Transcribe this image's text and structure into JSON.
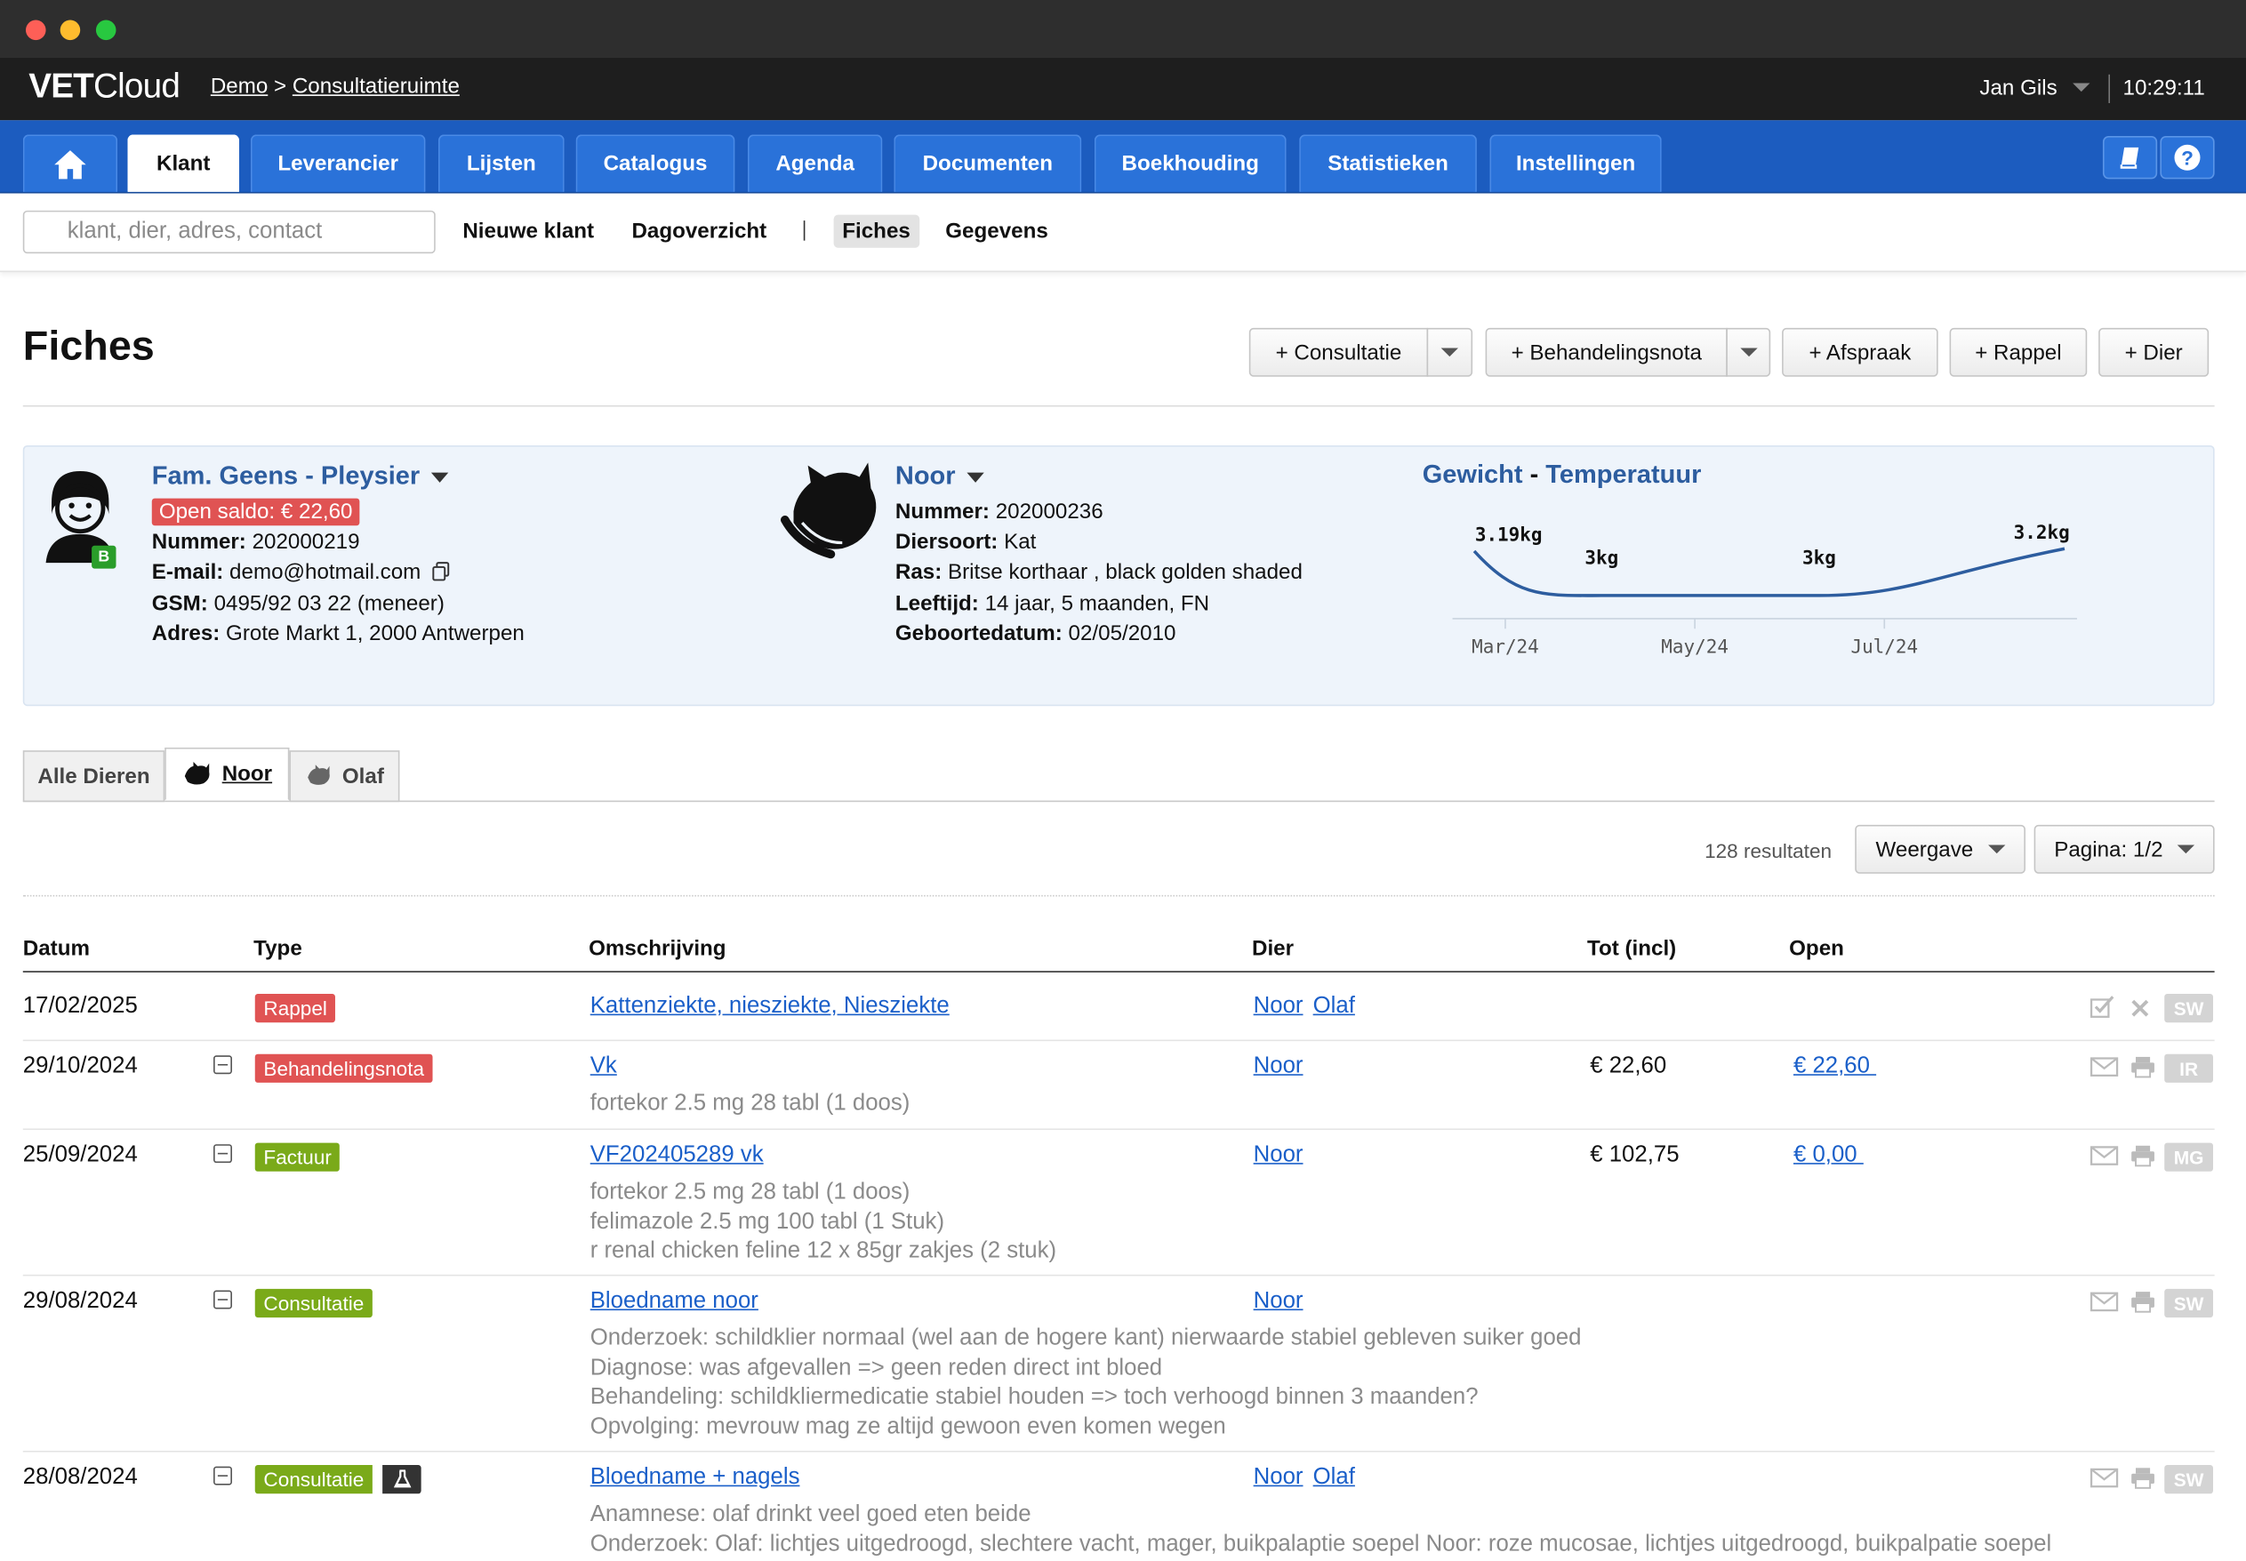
{
  "app": {
    "logo_bold": "VET",
    "logo_rest": "Cloud",
    "crumb_1": "Demo",
    "crumb_sep": ">",
    "crumb_2": "Consultatieruimte",
    "user": "Jan Gils",
    "time": "10:29:11"
  },
  "nav": {
    "tabs": [
      "Klant",
      "Leverancier",
      "Lijsten",
      "Catalogus",
      "Agenda",
      "Documenten",
      "Boekhouding",
      "Statistieken",
      "Instellingen"
    ],
    "active": "Klant"
  },
  "subnav": {
    "search_placeholder": "klant, dier, adres, contact",
    "links": [
      "Nieuwe klant",
      "Dagoverzicht",
      "Fiches",
      "Gegevens"
    ],
    "selected": "Fiches"
  },
  "page": {
    "title": "Fiches",
    "buttons": [
      "+ Consultatie",
      "+ Behandelingsnota",
      "+ Afspraak",
      "+ Rappel",
      "+ Dier"
    ]
  },
  "client": {
    "name": "Fam. Geens - Pleysier",
    "badge": "B",
    "saldo": "Open saldo: € 22,60",
    "fields": [
      {
        "label": "Nummer:",
        "value": "202000219"
      },
      {
        "label": "E-mail:",
        "value": "demo@hotmail.com"
      },
      {
        "label": "GSM:",
        "value": "0495/92 03 22 (meneer)"
      },
      {
        "label": "Adres:",
        "value": "Grote Markt 1, 2000 Antwerpen"
      }
    ]
  },
  "animal": {
    "name": "Noor",
    "fields": [
      {
        "label": "Nummer:",
        "value": "202000236"
      },
      {
        "label": "Diersoort:",
        "value": "Kat"
      },
      {
        "label": "Ras:",
        "value": "Britse korthaar , black golden shaded"
      },
      {
        "label": "Leeftijd:",
        "value": "14 jaar, 5 maanden, FN"
      },
      {
        "label": "Geboortedatum:",
        "value": "02/05/2010"
      }
    ]
  },
  "chart": {
    "title_a": "Gewicht",
    "title_sep": " - ",
    "title_b": "Temperatuur"
  },
  "chart_data": {
    "type": "line",
    "title": "Gewicht - Temperatuur",
    "x": [
      "2024-02-20",
      "2024-04-01",
      "2024-06-10",
      "2024-08-28"
    ],
    "series": [
      {
        "values": [
          3.19,
          3.0,
          3.0,
          3.2
        ]
      }
    ],
    "point_labels": [
      "3.19kg",
      "3kg",
      "3kg",
      "3.2kg"
    ],
    "tick_labels": [
      "Mar/24",
      "May/24",
      "Jul/24"
    ],
    "ylabel": "",
    "xlabel": "",
    "grid": false,
    "curve": "smooth",
    "color": "#2d5d9f"
  },
  "animal_tabs": [
    "Alle Dieren",
    "Noor",
    "Olaf"
  ],
  "animal_tab_active": "Noor",
  "results": {
    "count": "128 resultaten",
    "view": "Weergave",
    "page": "Pagina: 1/2"
  },
  "table": {
    "headers": [
      "Datum",
      "Type",
      "Omschrijving",
      "Dier",
      "Tot (incl)",
      "Open"
    ],
    "rows": [
      {
        "date": "17/02/2025",
        "type": "Rappel",
        "type_color": "#e05353",
        "title": "Kattenziekte, niesziekte, Niesziekte",
        "desc": [],
        "animals": [
          "Noor",
          "Olaf"
        ],
        "total": "",
        "open": "",
        "initials": "SW",
        "collapse": false,
        "lab": false,
        "actions": "check"
      },
      {
        "date": "29/10/2024",
        "type": "Behandelingsnota",
        "type_color": "#e05353",
        "title": "Vk",
        "desc": [
          "fortekor 2.5 mg 28 tabl (1 doos)"
        ],
        "animals": [
          "Noor"
        ],
        "total": "€ 22,60",
        "open": "€ 22,60 ",
        "initials": "IR",
        "collapse": true,
        "lab": false,
        "actions": "mail"
      },
      {
        "date": "25/09/2024",
        "type": "Factuur",
        "type_color": "#7aaa19",
        "title": "VF202405289 vk",
        "desc": [
          "fortekor 2.5 mg 28 tabl (1 doos)",
          "felimazole 2.5 mg 100 tabl (1 Stuk)",
          "r renal chicken feline 12 x 85gr zakjes (2 stuk)"
        ],
        "animals": [
          "Noor"
        ],
        "total": "€ 102,75",
        "open": "€ 0,00 ",
        "initials": "MG",
        "collapse": true,
        "lab": false,
        "actions": "mail"
      },
      {
        "date": "29/08/2024",
        "type": "Consultatie",
        "type_color": "#7aaa19",
        "title": "Bloedname noor",
        "desc": [
          "Onderzoek: schildklier normaal (wel aan de hogere kant) nierwaarde stabiel gebleven suiker goed",
          "Diagnose: was afgevallen => geen reden direct int bloed",
          "Behandeling: schildkliermedicatie stabiel houden => toch verhoogd binnen 3 maanden?",
          "Opvolging: mevrouw mag ze altijd gewoon even komen wegen"
        ],
        "animals": [
          "Noor"
        ],
        "total": "",
        "open": "",
        "initials": "SW",
        "collapse": true,
        "lab": false,
        "actions": "mail"
      },
      {
        "date": "28/08/2024",
        "type": "Consultatie",
        "type_color": "#7aaa19",
        "title": "Bloedname + nagels",
        "desc": [
          "Anamnese: olaf drinkt veel goed eten beide",
          "Onderzoek: Olaf: lichtjes uitgedroogd, slechtere vacht, mager, buikpalaptie soepel Noor: roze mucosae, lichtjes uitgedroogd, buikpalpatie soepel"
        ],
        "animals": [
          "Noor",
          "Olaf"
        ],
        "total": "",
        "open": "",
        "initials": "SW",
        "collapse": true,
        "lab": true,
        "actions": "mail"
      }
    ]
  }
}
